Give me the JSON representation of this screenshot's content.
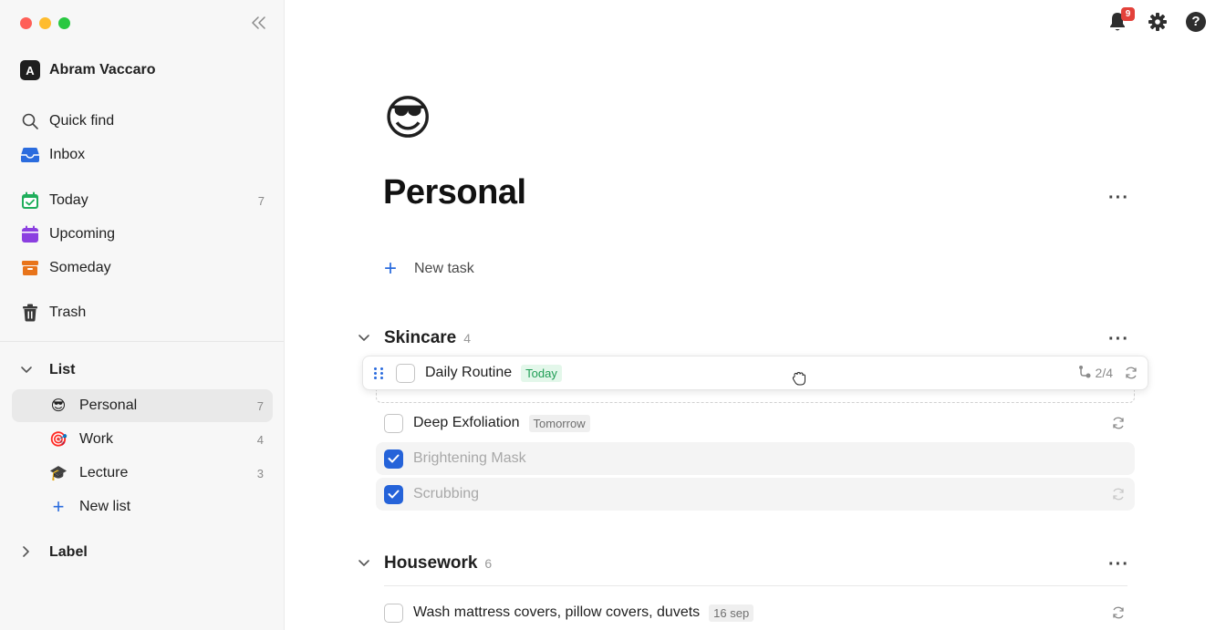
{
  "user": {
    "initial": "A",
    "name": "Abram Vaccaro"
  },
  "notifications": {
    "count": "9"
  },
  "sidebar": {
    "nav": [
      {
        "label": "Quick find",
        "icon": "search-icon"
      },
      {
        "label": "Inbox",
        "icon": "inbox-icon"
      }
    ],
    "views": [
      {
        "label": "Today",
        "count": "7",
        "icon": "calendar-check-icon"
      },
      {
        "label": "Upcoming",
        "count": "",
        "icon": "calendar-icon"
      },
      {
        "label": "Someday",
        "count": "",
        "icon": "archive-box-icon"
      }
    ],
    "trash": {
      "label": "Trash",
      "icon": "trash-icon"
    },
    "list_section": {
      "label": "List"
    },
    "lists": [
      {
        "emoji": "😎",
        "label": "Personal",
        "count": "7"
      },
      {
        "emoji": "🎯",
        "label": "Work",
        "count": "4"
      },
      {
        "emoji": "🎓",
        "label": "Lecture",
        "count": "3"
      }
    ],
    "new_list": "New list",
    "label_section": {
      "label": "Label"
    }
  },
  "page": {
    "emoji": "😎",
    "title": "Personal",
    "new_task": "New task"
  },
  "groups": [
    {
      "name": "Skincare",
      "count": "4",
      "tasks": [
        {
          "title": "Daily Routine",
          "chip": "Today",
          "subtasks": "2/4",
          "done": false
        },
        {
          "title": "Deep Exfoliation",
          "chip": "Tomorrow",
          "done": false
        },
        {
          "title": "Brightening Mask",
          "done": true
        },
        {
          "title": "Scrubbing",
          "done": true
        }
      ]
    },
    {
      "name": "Housework",
      "count": "6",
      "tasks": [
        {
          "title": "Wash mattress covers, pillow covers, duvets",
          "chip": "16 sep",
          "done": false
        }
      ]
    }
  ],
  "colors": {
    "accent": "#2563d9",
    "today_green": "#1f9d55",
    "badge_red": "#e3413a"
  }
}
